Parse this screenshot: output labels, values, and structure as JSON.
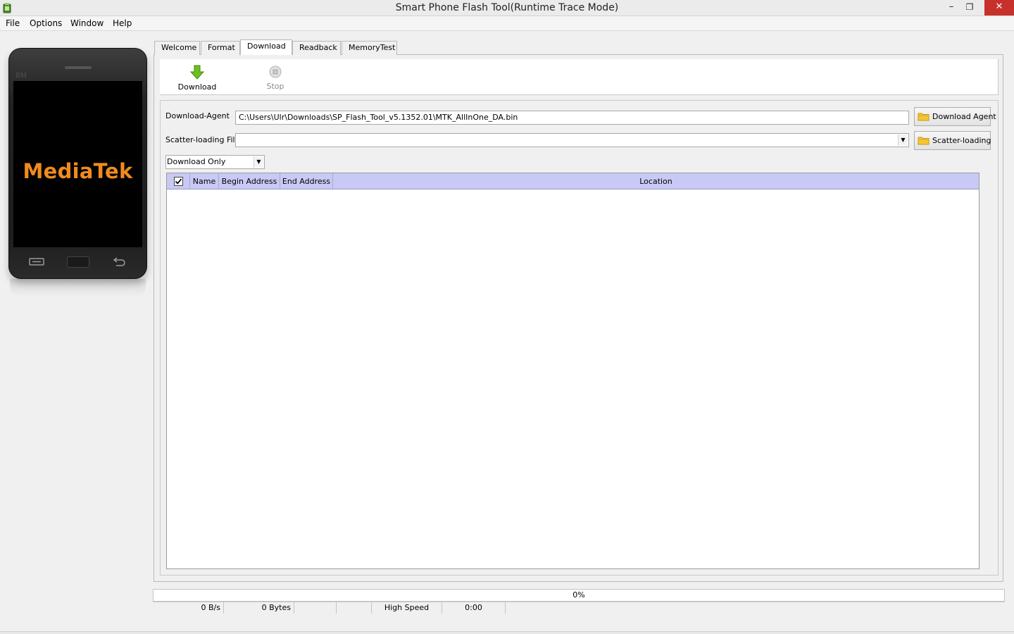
{
  "window": {
    "title": "Smart Phone Flash Tool(Runtime Trace Mode)",
    "controls": {
      "minimize": "–",
      "restore": "❐",
      "close": "✕"
    }
  },
  "menu": {
    "items": [
      "File",
      "Options",
      "Window",
      "Help"
    ]
  },
  "phone": {
    "brand": "BM",
    "logo": "MediaTek"
  },
  "tabs": [
    "Welcome",
    "Format",
    "Download",
    "Readback",
    "MemoryTest"
  ],
  "active_tab": "Download",
  "toolbar": {
    "download_label": "Download",
    "stop_label": "Stop"
  },
  "form": {
    "download_agent_label": "Download-Agent",
    "download_agent_value": "C:\\Users\\Ulr\\Downloads\\SP_Flash_Tool_v5.1352.01\\MTK_AllInOne_DA.bin",
    "download_agent_button": "Download Agent",
    "scatter_label": "Scatter-loading File",
    "scatter_value": "",
    "scatter_button": "Scatter-loading",
    "mode_value": "Download Only"
  },
  "table": {
    "checked": true,
    "columns": [
      "Name",
      "Begin Address",
      "End Address",
      "Location"
    ],
    "rows": []
  },
  "status": {
    "progress_text": "0%",
    "progress_value": 0,
    "speed": "0 B/s",
    "bytes": "0 Bytes",
    "usb_mode": "High Speed",
    "time": "0:00"
  },
  "colors": {
    "table_header": "#c9c9f5",
    "logo": "#f08b1e",
    "close_button": "#c7312b",
    "download_arrow": "#6fbf1f"
  }
}
